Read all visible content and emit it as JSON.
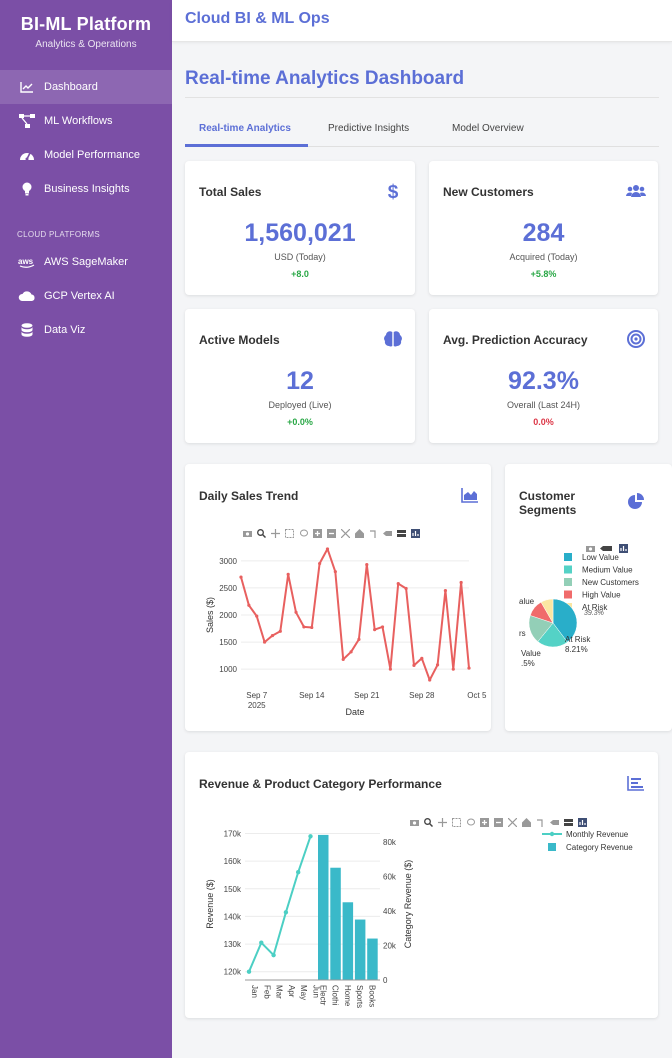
{
  "brand": {
    "title": "BI-ML Platform",
    "subtitle": "Analytics & Operations"
  },
  "sidebar": {
    "items": [
      {
        "label": "Dashboard",
        "icon": "line-chart-icon",
        "active": true
      },
      {
        "label": "ML Workflows",
        "icon": "workflow-icon"
      },
      {
        "label": "Model Performance",
        "icon": "gauge-icon"
      },
      {
        "label": "Business Insights",
        "icon": "lightbulb-icon"
      }
    ],
    "section_label": "CLOUD PLATFORMS",
    "platforms": [
      {
        "label": "AWS SageMaker",
        "icon": "aws-icon"
      },
      {
        "label": "GCP Vertex AI",
        "icon": "cloud-icon"
      },
      {
        "label": "Data Viz",
        "icon": "database-icon"
      }
    ]
  },
  "header": {
    "title": "Cloud BI & ML Ops"
  },
  "page": {
    "title": "Real-time Analytics Dashboard"
  },
  "tabs": [
    {
      "label": "Real-time Analytics",
      "active": true
    },
    {
      "label": "Predictive Insights"
    },
    {
      "label": "Model Overview"
    }
  ],
  "kpis": [
    {
      "label": "Total Sales",
      "value": "1,560,021",
      "sub": "USD (Today)",
      "change": "+8.0",
      "trend": "up",
      "icon": "dollar-icon"
    },
    {
      "label": "New Customers",
      "value": "284",
      "sub": "Acquired (Today)",
      "change": "+5.8%",
      "trend": "up",
      "icon": "users-icon"
    },
    {
      "label": "Active Models",
      "value": "12",
      "sub": "Deployed (Live)",
      "change": "+0.0%",
      "trend": "up",
      "icon": "brain-icon"
    },
    {
      "label": "Avg. Prediction Accuracy",
      "value": "92.3%",
      "sub": "Overall (Last 24H)",
      "change": "0.0%",
      "trend": "down",
      "icon": "target-icon"
    }
  ],
  "colors": {
    "accent": "#5c6fd6",
    "sidebar": "#7b4fa6",
    "line_red": "#e8605f",
    "teal": "#3ab9c9",
    "line_teal": "#4ccfc4",
    "up": "#28a745",
    "down": "#dc3545"
  },
  "charts": {
    "sales_trend_title": "Daily Sales Trend",
    "segments_title": "Customer Segments",
    "revenue_title": "Revenue & Product Category Performance"
  },
  "chart_data": [
    {
      "type": "line",
      "title": "Daily Sales Trend",
      "xlabel": "Date",
      "ylabel": "Sales ($)",
      "x_ticks": [
        "Sep 7\n2025",
        "Sep 14",
        "Sep 21",
        "Sep 28",
        "Oct 5"
      ],
      "y_ticks": [
        1000,
        1500,
        2000,
        2500,
        3000
      ],
      "ylim": [
        800,
        3200
      ],
      "series": [
        {
          "color": "#e8605f",
          "x": [
            "2025-09-05",
            "2025-09-06",
            "2025-09-07",
            "2025-09-08",
            "2025-09-09",
            "2025-09-10",
            "2025-09-11",
            "2025-09-12",
            "2025-09-13",
            "2025-09-14",
            "2025-09-15",
            "2025-09-16",
            "2025-09-17",
            "2025-09-18",
            "2025-09-19",
            "2025-09-20",
            "2025-09-21",
            "2025-09-22",
            "2025-09-23",
            "2025-09-24",
            "2025-09-25",
            "2025-09-26",
            "2025-09-27",
            "2025-09-28",
            "2025-09-29",
            "2025-09-30",
            "2025-10-01",
            "2025-10-02",
            "2025-10-03",
            "2025-10-04"
          ],
          "values": [
            2700,
            2180,
            1980,
            1500,
            1620,
            1700,
            2750,
            2050,
            1780,
            1770,
            2950,
            3220,
            2800,
            1180,
            1320,
            1550,
            2930,
            1730,
            1780,
            1000,
            2580,
            2490,
            1070,
            1200,
            800,
            1080,
            2450,
            1000,
            2600,
            1020
          ]
        }
      ]
    },
    {
      "type": "pie",
      "title": "Customer Segments",
      "legend": [
        {
          "label": "Low Value",
          "color": "#29aec9"
        },
        {
          "label": "Medium Value",
          "color": "#54d2c6"
        },
        {
          "label": "New Customers",
          "color": "#93cfb7"
        },
        {
          "label": "High Value",
          "color": "#f06b6b"
        },
        {
          "label": "At Risk",
          "color": "#fbe6a2"
        }
      ],
      "values": [
        39.3,
        21.0,
        19.0,
        11.5,
        8.21
      ],
      "slice_labels": [
        "39.3%",
        "At Risk\n8.21%",
        "Value\n.5%"
      ],
      "partial_labels": [
        "alue",
        "rs"
      ]
    },
    {
      "type": "bar",
      "title": "Revenue & Product Category Performance",
      "legend": [
        "Monthly Revenue",
        "Category Revenue"
      ],
      "line": {
        "name": "Monthly Revenue",
        "categories": [
          "Jan",
          "Feb",
          "Mar",
          "Apr",
          "May",
          "Jun"
        ],
        "values": [
          120000,
          130500,
          126000,
          141500,
          156000,
          169000
        ],
        "ylabel": "Revenue ($)",
        "y_ticks": [
          "120k",
          "130k",
          "140k",
          "150k",
          "160k",
          "170k"
        ],
        "ylim": [
          117000,
          172000
        ]
      },
      "bars": {
        "name": "Category Revenue",
        "categories": [
          "Electr",
          "Clothi",
          "Home",
          "Sports",
          "Books"
        ],
        "values": [
          84000,
          65000,
          45000,
          35000,
          24000
        ],
        "ylabel": "Category Revenue ($)",
        "y_ticks": [
          "0",
          "20k",
          "40k",
          "60k",
          "80k"
        ],
        "ylim": [
          0,
          88000
        ]
      }
    }
  ]
}
